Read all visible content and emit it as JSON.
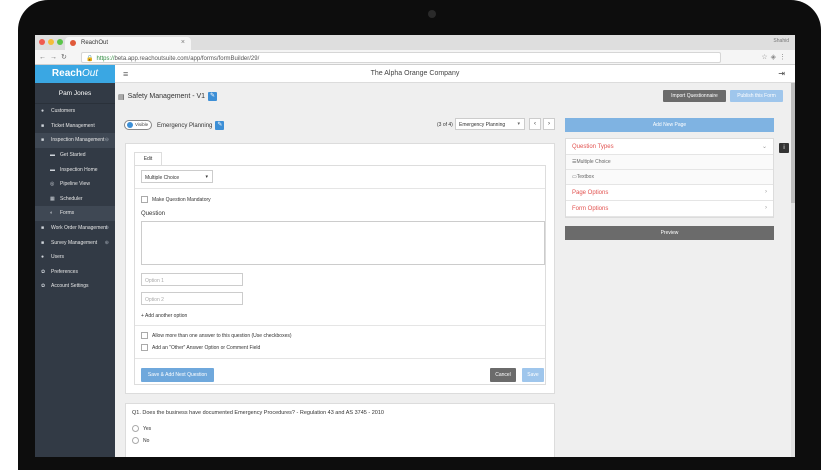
{
  "browser": {
    "tab_title": "ReachOut",
    "user_chip": "Shahid",
    "url_secure": "https://",
    "url_rest": "beta.app.reachoutsuite.com/app/forms/formBuilder/29/"
  },
  "header": {
    "logo_main": "Reach",
    "logo_script": "Out",
    "company": "The Alpha Orange Company"
  },
  "sidebar": {
    "user_name": "Pam Jones",
    "items": [
      {
        "label": "Customers",
        "icon": "users-icon"
      },
      {
        "label": "Ticket Management",
        "icon": "ticket-icon"
      },
      {
        "label": "Inspection Management",
        "icon": "clipboard-icon"
      },
      {
        "label": "Get Started",
        "icon": "folder-icon"
      },
      {
        "label": "Inspection Home",
        "icon": "folder-icon"
      },
      {
        "label": "Pipeline View",
        "icon": "pipeline-icon"
      },
      {
        "label": "Scheduler",
        "icon": "calendar-icon"
      },
      {
        "label": "Forms",
        "icon": "forms-icon"
      },
      {
        "label": "Work Order Management",
        "icon": "briefcase-icon"
      },
      {
        "label": "Survey Management",
        "icon": "survey-icon"
      },
      {
        "label": "Users",
        "icon": "user-icon"
      },
      {
        "label": "Preferences",
        "icon": "gear-icon"
      },
      {
        "label": "Account Settings",
        "icon": "gear-icon"
      }
    ]
  },
  "main": {
    "form_title": "Safety Management - V1",
    "import_label": "Import Questionnaire",
    "publish_label": "Publish this Form",
    "visible_label": "Visible",
    "section_name": "Emergency Planning",
    "pager_count": "(3 of 4)",
    "pager_select": "Emergency Planning"
  },
  "right_panel": {
    "add_page_label": "Add New Page",
    "question_types_label": "Question Types",
    "question_type_options": [
      "Multiple Choice",
      "Textbox"
    ],
    "page_options_label": "Page Options",
    "form_options_label": "Form Options",
    "preview_label": "Preview"
  },
  "editor": {
    "tab_label": "Edit",
    "question_type": "Multiple Choice",
    "mandatory_label": "Make Question Mandatory",
    "question_label": "Question",
    "option1_placeholder": "Option 1",
    "option2_placeholder": "Option 2",
    "add_option_label": "+ Add another option",
    "allow_multiple_label": "Allow more than one answer to this question (Use checkboxes)",
    "other_option_label": "Add an \"Other\" Answer Option or Comment Field",
    "save_next_label": "Save & Add Next Question",
    "cancel_label": "Cancel",
    "save_label": "Save"
  },
  "question_preview": {
    "text": "Q1.  Does the business have documented Emergency Procedures? - Regulation 43 and AS 3745 - 2010",
    "answers": [
      "Yes",
      "No"
    ]
  },
  "colors": {
    "brand": "#3aa7e3",
    "sidebar_bg": "#323a45",
    "accent_red": "#e2524f",
    "primary_button": "#6fa8dc",
    "dark_button": "#6b6b6b"
  }
}
